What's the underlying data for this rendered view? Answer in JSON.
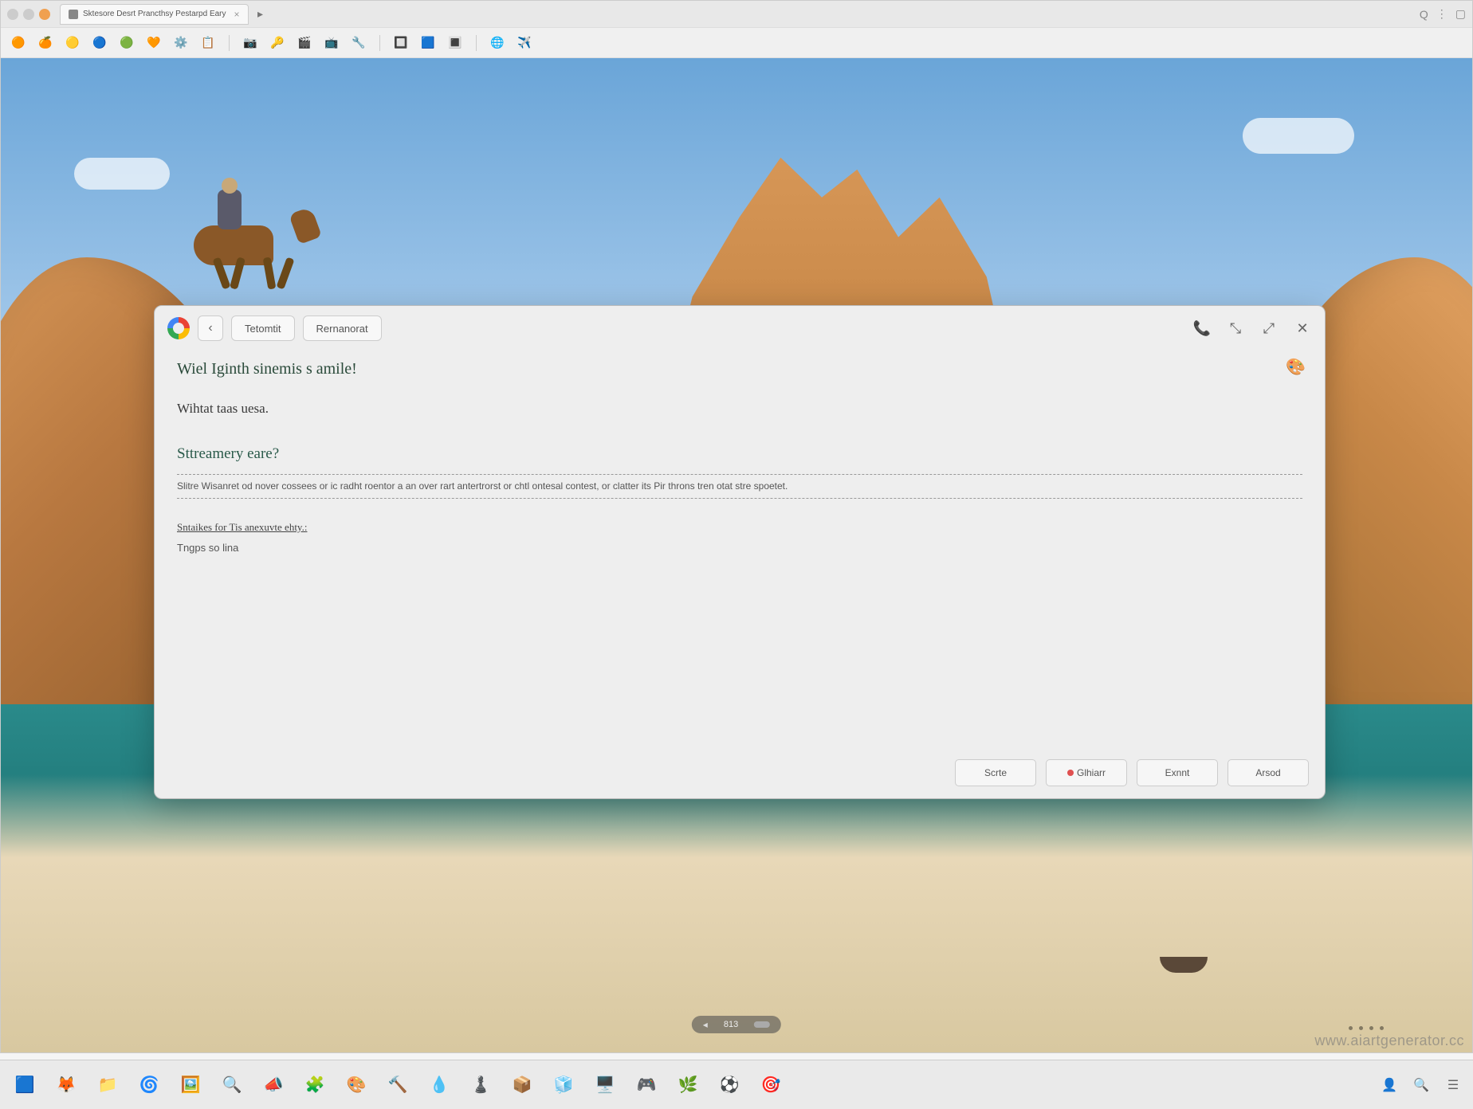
{
  "browser": {
    "tab_title": "Sktesore Desrt Prancthsy Pestarpd Eary",
    "right_icons": [
      "Q",
      "⋮",
      "□"
    ]
  },
  "dialog": {
    "header": {
      "tab1": "Tetomtit",
      "tab2": "Rernanorat"
    },
    "title": "Wiel Iginth sinemis s amile!",
    "subtitle": "Wihtat taas uesa.",
    "section": "Sttreamery eare?",
    "paragraph": "Slitre Wisanret od nover cossees or ic radht roentor a an over rart antertrorst or chtl ontesal contest, or clatter its Pir throns tren otat stre spoetet.",
    "sub2": "Sntaikes for Tis anexuvte ehty.:",
    "line": "Tngps so lina",
    "buttons": {
      "b1": "Scrte",
      "b2": "Glhiarr",
      "b3": "Exnnt",
      "b4": "Arsod"
    }
  },
  "indicator": {
    "label": "813"
  },
  "watermark": "www.aiartgenerator.cc"
}
